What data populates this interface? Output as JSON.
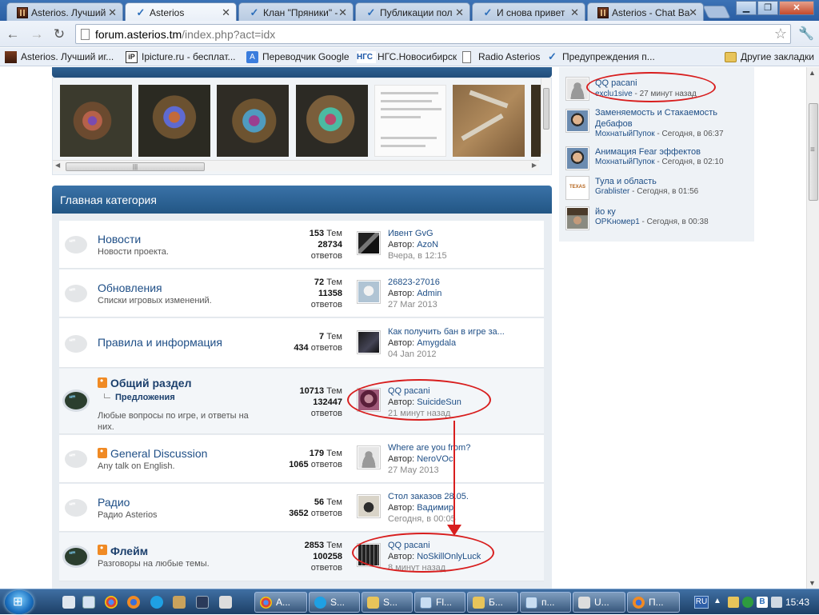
{
  "tabs": [
    {
      "title": "Asterios. Лучший",
      "icon": "asterios-icon",
      "active": false
    },
    {
      "title": "Asterios",
      "icon": "vk-icon",
      "active": true
    },
    {
      "title": "Клан \"Пряники\" -",
      "icon": "vk-icon",
      "active": false
    },
    {
      "title": "Публикации пол",
      "icon": "vk-icon",
      "active": false
    },
    {
      "title": "И снова привет",
      "icon": "vk-icon",
      "active": false
    },
    {
      "title": "Asterios - Chat Ba",
      "icon": "asterios-icon",
      "active": false
    }
  ],
  "window_buttons": {
    "minimize": "▁",
    "maximize": "❐",
    "close": "✕"
  },
  "toolbar": {
    "url_host": "forum.asterios.tm",
    "url_path": "/index.php?act=idx",
    "back": "←",
    "forward": "→",
    "reload": "↻",
    "star": "☆",
    "menu": "🔧"
  },
  "bookmarks": [
    {
      "label": "Asterios. Лучший иг...",
      "icon": "asterios-icon"
    },
    {
      "label": "Ipicture.ru - бесплат...",
      "icon": "ipicture-icon"
    },
    {
      "label": "Переводчик Google",
      "icon": "google-translate-icon"
    },
    {
      "label": "НГС.Новосибирск",
      "icon": "ngs-icon"
    },
    {
      "label": "Radio Asterios",
      "icon": "page-icon"
    },
    {
      "label": "Предупреждения п...",
      "icon": "vk-icon"
    }
  ],
  "other_bookmarks": "Другие закладки",
  "category": {
    "title": "Главная категория",
    "forums": [
      {
        "name": "Новости",
        "desc": "Новости проекта.",
        "topics": "153",
        "posts": "28734",
        "topics_lbl": "Тем",
        "posts_lbl": "ответов",
        "last_title": "Ивент GvG",
        "last_author": "AzoN",
        "last_date": "Вчера, в 12:15",
        "author_prefix": "Автор: "
      },
      {
        "name": "Обновления",
        "desc": "Списки игровых изменений.",
        "topics": "72",
        "posts": "11358",
        "topics_lbl": "Тем",
        "posts_lbl": "ответов",
        "last_title": "26823-27016",
        "last_author": "Admin",
        "last_date": "27 Mar 2013",
        "author_prefix": "Автор: "
      },
      {
        "name": "Правила и информация",
        "desc": "",
        "topics": "7",
        "posts": "434",
        "topics_lbl": "Тем",
        "posts_lbl": "ответов",
        "last_title": "Как получить бан в игре за...",
        "last_author": "Amygdala",
        "last_date": "04 Jan 2012",
        "author_prefix": "Автор: "
      },
      {
        "name": "Общий раздел",
        "sub": "Предложения",
        "desc": "Любые вопросы по игре, и ответы на них.",
        "topics": "10713",
        "posts": "132447",
        "topics_lbl": "Тем",
        "posts_lbl": "ответов",
        "last_title": "QQ pacani",
        "last_author": "SuicideSun",
        "last_date": "21 минут назад",
        "author_prefix": "Автор: "
      },
      {
        "name": "General Discussion",
        "desc": "Any talk on English.",
        "topics": "179",
        "posts": "1065",
        "topics_lbl": "Тем",
        "posts_lbl": "ответов",
        "last_title": "Where are you from?",
        "last_author": "NeroVOc",
        "last_date": "27 May 2013",
        "author_prefix": "Автор: "
      },
      {
        "name": "Радио",
        "desc": "Радио Asterios",
        "topics": "56",
        "posts": "3652",
        "topics_lbl": "Тем",
        "posts_lbl": "ответов",
        "last_title": "Стол заказов 28.05.",
        "last_author": "Вадимир",
        "last_date": "Сегодня, в 00:05",
        "author_prefix": "Автор: "
      },
      {
        "name": "Флейм",
        "desc": "Разговоры на любые темы.",
        "topics": "2853",
        "posts": "100258",
        "topics_lbl": "Тем",
        "posts_lbl": "ответов",
        "last_title": "QQ pacani",
        "last_author": "NoSkillOnlyLuck",
        "last_date": "8 минут назад",
        "author_prefix": "Автор: "
      }
    ]
  },
  "sidebar": {
    "items": [
      {
        "title": "QQ pacani",
        "author": "exclu1sive",
        "time": " - 27 минут назад"
      },
      {
        "title": "Заменяемость и Стакаемость Дебафов",
        "author": "МохнатыйПупок",
        "time": " - Сегодня, в 06:37"
      },
      {
        "title": "Анимация Fear эффектов",
        "author": "МохнатыйПупок",
        "time": " - Сегодня, в 02:10"
      },
      {
        "title": "Тула и область",
        "author": "Grablister",
        "time": " - Сегодня, в 01:56"
      },
      {
        "title": "йо ку",
        "author": "OPKномер1",
        "time": " - Сегодня, в 00:38"
      }
    ]
  },
  "taskbar": {
    "tasks": [
      {
        "label": "A...",
        "icon": "chrome-icon"
      },
      {
        "label": "S...",
        "icon": "skype-icon"
      },
      {
        "label": "S...",
        "icon": "folder-icon"
      },
      {
        "label": "Fl...",
        "icon": "flash-icon"
      },
      {
        "label": "Б...",
        "icon": "folder-icon"
      },
      {
        "label": "п...",
        "icon": "window-icon"
      },
      {
        "label": "U...",
        "icon": "drive-icon"
      },
      {
        "label": "П...",
        "icon": "firefox-icon"
      }
    ],
    "lang": "RU",
    "clock": "15:43"
  },
  "colors": {
    "annotation": "#d81e1e",
    "category_header": "#225684",
    "link": "#1e4e86"
  }
}
